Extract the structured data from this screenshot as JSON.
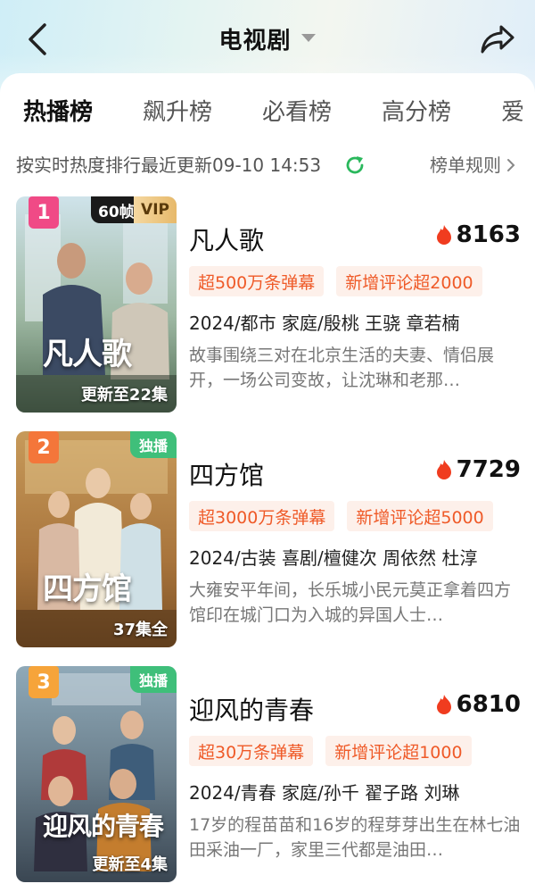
{
  "header": {
    "title": "电视剧"
  },
  "tabs": [
    {
      "label": "热播榜",
      "active": true
    },
    {
      "label": "飙升榜",
      "active": false
    },
    {
      "label": "必看榜",
      "active": false
    },
    {
      "label": "高分榜",
      "active": false
    },
    {
      "label": "爱",
      "active": false
    }
  ],
  "subbar": {
    "update_text": "按实时热度排行最近更新09-10 14:53",
    "rules_label": "榜单规则"
  },
  "colors": {
    "accent_green": "#2ab85c",
    "chip_text": "#ef5a28",
    "chip_bg": "#fdf0ea",
    "heat_icon": "#f03c1f"
  },
  "items": [
    {
      "rank": "1",
      "rank_color": "#f04a86",
      "tag_fps": "60帧",
      "tag_vip": "VIP",
      "episode": "更新至22集",
      "poster_logo": "凡人歌",
      "title": "凡人歌",
      "heat": "8163",
      "chips": [
        "超500万条弹幕",
        "新增评论超2000"
      ],
      "meta": "2024/都市 家庭/殷桃 王骁 章若楠",
      "desc": "故事围绕三对在北京生活的夫妻、情侣展开，一场公司变故，让沈琳和老那…"
    },
    {
      "rank": "2",
      "rank_color": "#f4763a",
      "tag_excl": "独播",
      "episode": "37集全",
      "poster_logo": "四方馆",
      "title": "四方馆",
      "heat": "7729",
      "chips": [
        "超3000万条弹幕",
        "新增评论超5000"
      ],
      "meta": "2024/古装 喜剧/檀健次 周依然 杜淳",
      "desc": "大雍安平年间，长乐城小民元莫正拿着四方馆印在城门口为入城的异国人士…"
    },
    {
      "rank": "3",
      "rank_color": "#f6a43a",
      "tag_excl": "独播",
      "episode": "更新至4集",
      "poster_logo": "迎风的青春",
      "title": "迎风的青春",
      "heat": "6810",
      "chips": [
        "超30万条弹幕",
        "新增评论超1000"
      ],
      "meta": "2024/青春 家庭/孙千 翟子路 刘琳",
      "desc": "17岁的程苗苗和16岁的程芽芽出生在林七油田采油一厂，家里三代都是油田…"
    }
  ]
}
